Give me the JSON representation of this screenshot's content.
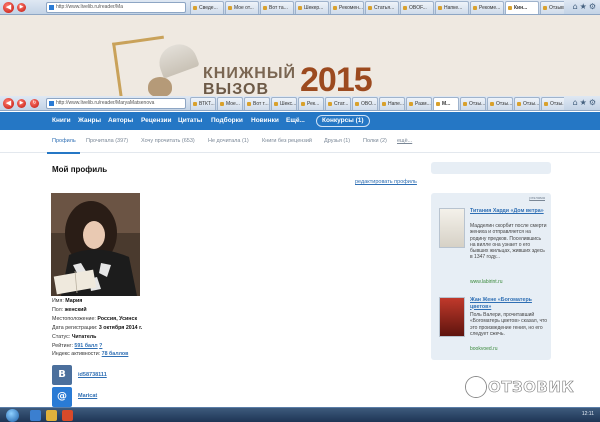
{
  "browser_back": {
    "url": "http://www.livelib.ru/reader/Ma",
    "tabs": [
      "Сведе...",
      "Мое от...",
      "Вот та...",
      "Шекер...",
      "Рекомен...",
      "Статья...",
      "OBOF...",
      "Напке...",
      "Рекоме...",
      "Кин...",
      "Отзыв..."
    ]
  },
  "banner": {
    "line1": "КНИЖНЫЙ",
    "line2": "ВЫЗОВ",
    "year": "2015"
  },
  "browser_front": {
    "url": "http://www.livelib.ru/reader/MaryaMatsenova",
    "tabs": [
      "ВТКТ...",
      "Мое...",
      "Вот т...",
      "Шекс...",
      "Рек...",
      "Стат...",
      "OBO...",
      "Напе...",
      "Разм...",
      "М...",
      "Отзы...",
      "Отзы...",
      "Отзы...",
      "Отзы..."
    ]
  },
  "main_nav": {
    "items": [
      "Книги",
      "Жанры",
      "Авторы",
      "Рецензии",
      "Цитаты",
      "Подборки",
      "Новинки",
      "Ещё..."
    ],
    "contests": "Конкурсы (1)"
  },
  "sub_nav": {
    "items": [
      "Профиль",
      "Прочитала (397)",
      "Хочу прочитать (653)",
      "Не дочитала (1)",
      "Книги без рецензий",
      "Друзья (1)",
      "Полки (2)",
      "ещё..."
    ]
  },
  "profile": {
    "title": "Мой профиль",
    "edit_link": "редактировать профиль",
    "name_label": "Имя:",
    "name": "Мария",
    "gender_label": "Пол:",
    "gender": "женский",
    "location_label": "Местоположение:",
    "location": "Россия, Усинск",
    "registered_label": "Дата регистрации:",
    "registered": "3 октября 2014 г.",
    "status_label": "Статус:",
    "status": "Читатель",
    "rating_label": "Рейтинг:",
    "rating": "591 балл",
    "rating_help": "?",
    "activity_label": "Индекс активности:",
    "activity": "78 баллов"
  },
  "social": {
    "vk_letter": "В",
    "vk_id": "id58738111",
    "mail_symbol": "@",
    "mail_id": "Maricat"
  },
  "sidebar": {
    "ad_label": "реклама",
    "ads": [
      {
        "title": "Титания Харди «Дом ветра»",
        "text": "Мадделин скорбит после смерти жениха и отправляется на родину предков. Поселившись на вилле она узнает о его бывших жильцах, живших здесь в 1347 году...",
        "source": "www.labirint.ru"
      },
      {
        "title": "Жан Жене «Богоматерь цветов»",
        "text": "Поль Валери, прочитавший «Богоматерь цветов» сказал, что это произведение гения, но его следует сжечь.",
        "source": "bookvoed.ru"
      }
    ]
  },
  "taskbar": {
    "clock": "12:11"
  },
  "watermark": "ОТЗОВИК",
  "colors": {
    "nav_blue": "#2577c5",
    "link_blue": "#2f6fb4",
    "sidebar_bg": "#e7eef5"
  }
}
